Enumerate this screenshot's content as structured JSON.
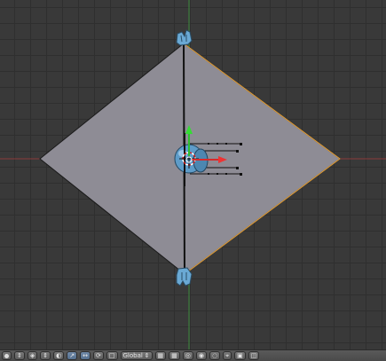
{
  "viewport": {
    "name": "3D Viewport",
    "grid": true,
    "colors": {
      "background": "#393939",
      "grid_line": "#2f2f2f",
      "axis_x": "#8c3a3a",
      "axis_y": "#3d8a3d",
      "mesh_face": "#8e8c95",
      "selected_edge": "#e8a033"
    }
  },
  "header": {
    "transform_orientation": "Global",
    "icons": [
      "view-sphere-icon",
      "object-mode-icon",
      "manipulator-icon",
      "translate-icon",
      "rotate-icon",
      "scale-icon",
      "layer-icon",
      "pivot-icon",
      "snap-icon",
      "snap-target-icon",
      "proportional-edit-icon",
      "render-icon"
    ]
  }
}
